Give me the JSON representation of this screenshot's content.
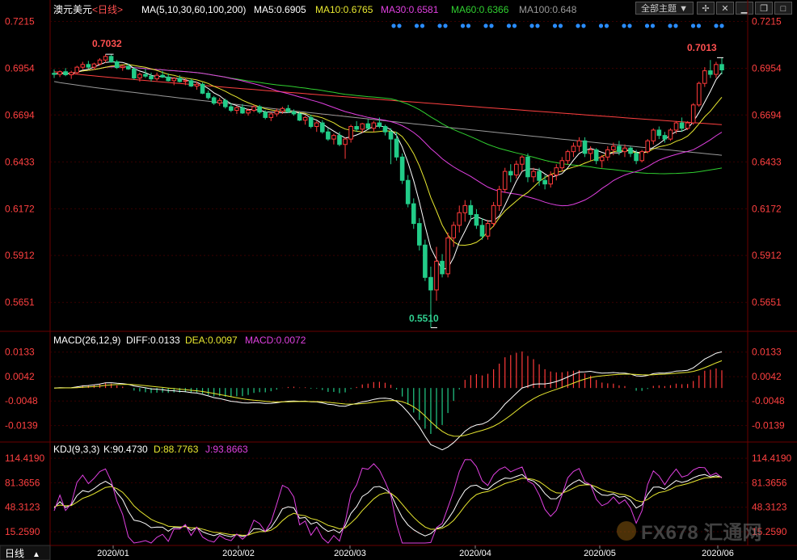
{
  "toolbar": {
    "theme_select": "全部主题",
    "icons": [
      "cross-icon",
      "close-icon",
      "minimize-icon",
      "restore-icon",
      "maximize-icon"
    ]
  },
  "price_panel": {
    "symbol": "澳元美元",
    "period_tag": "<日线>",
    "ma_header": "MA(5,10,30,60,100,200)",
    "ma_values": [
      {
        "label": "MA5:0.6905",
        "color": "#ffffff"
      },
      {
        "label": "MA10:0.6765",
        "color": "#e8e830"
      },
      {
        "label": "MA30:0.6581",
        "color": "#e040e0"
      },
      {
        "label": "MA60:0.6366",
        "color": "#30d030"
      },
      {
        "label": "MA100:0.648",
        "color": "#9a9a9a"
      }
    ],
    "annotations": {
      "high_left": "0.7032",
      "high_right": "0.7013",
      "low": "0.5510"
    }
  },
  "macd_panel": {
    "header": "MACD(26,12,9)",
    "diff": "DIFF:0.0133",
    "dea": "DEA:0.0097",
    "macd": "MACD:0.0072",
    "ticks": [
      "0.0133",
      "0.0042",
      "-0.0048",
      "-0.0139"
    ]
  },
  "kdj_panel": {
    "header": "KDJ(9,3,3)",
    "k": "K:90.4730",
    "d": "D:88.7763",
    "j": "J:93.8663",
    "ticks": [
      "114.4190",
      "81.3656",
      "48.3123",
      "15.2590"
    ]
  },
  "bottom_bar": {
    "period_label": "日线",
    "watermark": "FX678 汇通网"
  },
  "colors": {
    "up": "#ff3a3a",
    "down": "#22cc88",
    "axis_label": "#ff4040",
    "grid": "#3a0000",
    "ma5": "#ffffff",
    "ma10": "#e8e830",
    "ma30": "#e040e0",
    "ma60": "#30d030",
    "ma100": "#9a9a9a",
    "ma200": "#ff4040"
  },
  "chart_data": {
    "type": "candlestick",
    "x_axis_labels": [
      "2020/01",
      "2020/02",
      "2020/03",
      "2020/04",
      "2020/05",
      "2020/06"
    ],
    "price_axis_ticks": [
      0.7215,
      0.6954,
      0.6694,
      0.6433,
      0.6172,
      0.5912,
      0.5651
    ],
    "price_range": [
      0.549,
      0.7235
    ],
    "extremes": {
      "high": 0.7032,
      "recent_high": 0.7013,
      "low": 0.551
    },
    "ohlc": [
      [
        0.6926,
        0.6948,
        0.69,
        0.692
      ],
      [
        0.692,
        0.6942,
        0.6905,
        0.6935
      ],
      [
        0.6935,
        0.6955,
        0.691,
        0.6918
      ],
      [
        0.6918,
        0.694,
        0.6895,
        0.693
      ],
      [
        0.693,
        0.6968,
        0.692,
        0.696
      ],
      [
        0.696,
        0.699,
        0.6948,
        0.6975
      ],
      [
        0.6975,
        0.6995,
        0.695,
        0.696
      ],
      [
        0.696,
        0.6985,
        0.6945,
        0.6978
      ],
      [
        0.6978,
        0.701,
        0.697,
        0.7
      ],
      [
        0.7,
        0.7032,
        0.6985,
        0.702
      ],
      [
        0.702,
        0.703,
        0.6985,
        0.699
      ],
      [
        0.699,
        0.7,
        0.695,
        0.6958
      ],
      [
        0.6958,
        0.6975,
        0.694,
        0.6965
      ],
      [
        0.6965,
        0.698,
        0.6945,
        0.695
      ],
      [
        0.695,
        0.696,
        0.689,
        0.69
      ],
      [
        0.69,
        0.693,
        0.688,
        0.692
      ],
      [
        0.692,
        0.695,
        0.69,
        0.691
      ],
      [
        0.691,
        0.693,
        0.688,
        0.6895
      ],
      [
        0.6895,
        0.693,
        0.6885,
        0.6915
      ],
      [
        0.6915,
        0.694,
        0.69,
        0.6905
      ],
      [
        0.6905,
        0.6925,
        0.688,
        0.6885
      ],
      [
        0.6885,
        0.6905,
        0.686,
        0.6898
      ],
      [
        0.6898,
        0.6915,
        0.6875,
        0.688
      ],
      [
        0.688,
        0.69,
        0.686,
        0.6885
      ],
      [
        0.6885,
        0.6895,
        0.685,
        0.6855
      ],
      [
        0.6855,
        0.688,
        0.6835,
        0.6865
      ],
      [
        0.6865,
        0.6875,
        0.681,
        0.6815
      ],
      [
        0.6815,
        0.683,
        0.678,
        0.679
      ],
      [
        0.679,
        0.68,
        0.675,
        0.676
      ],
      [
        0.676,
        0.679,
        0.6745,
        0.6775
      ],
      [
        0.6775,
        0.6785,
        0.673,
        0.674
      ],
      [
        0.674,
        0.676,
        0.671,
        0.672
      ],
      [
        0.672,
        0.6745,
        0.67,
        0.6735
      ],
      [
        0.6735,
        0.6755,
        0.67,
        0.6705
      ],
      [
        0.6705,
        0.673,
        0.669,
        0.672
      ],
      [
        0.672,
        0.675,
        0.671,
        0.674
      ],
      [
        0.674,
        0.675,
        0.67,
        0.671
      ],
      [
        0.671,
        0.672,
        0.667,
        0.668
      ],
      [
        0.668,
        0.671,
        0.666,
        0.67
      ],
      [
        0.67,
        0.673,
        0.6685,
        0.6715
      ],
      [
        0.6715,
        0.674,
        0.67,
        0.673
      ],
      [
        0.673,
        0.675,
        0.6705,
        0.6712
      ],
      [
        0.6712,
        0.6725,
        0.669,
        0.67
      ],
      [
        0.67,
        0.671,
        0.666,
        0.6665
      ],
      [
        0.6665,
        0.669,
        0.664,
        0.668
      ],
      [
        0.668,
        0.6695,
        0.662,
        0.663
      ],
      [
        0.663,
        0.666,
        0.66,
        0.665
      ],
      [
        0.665,
        0.6665,
        0.659,
        0.66
      ],
      [
        0.66,
        0.662,
        0.655,
        0.656
      ],
      [
        0.656,
        0.659,
        0.653,
        0.658
      ],
      [
        0.658,
        0.66,
        0.652,
        0.653
      ],
      [
        0.653,
        0.657,
        0.645,
        0.656
      ],
      [
        0.656,
        0.664,
        0.654,
        0.663
      ],
      [
        0.663,
        0.666,
        0.66,
        0.6615
      ],
      [
        0.6615,
        0.665,
        0.6595,
        0.6645
      ],
      [
        0.6645,
        0.667,
        0.661,
        0.662
      ],
      [
        0.662,
        0.666,
        0.66,
        0.665
      ],
      [
        0.665,
        0.668,
        0.662,
        0.663
      ],
      [
        0.663,
        0.664,
        0.658,
        0.66
      ],
      [
        0.66,
        0.662,
        0.642,
        0.656
      ],
      [
        0.656,
        0.66,
        0.644,
        0.646
      ],
      [
        0.646,
        0.648,
        0.631,
        0.633
      ],
      [
        0.633,
        0.636,
        0.618,
        0.62
      ],
      [
        0.62,
        0.623,
        0.606,
        0.609
      ],
      [
        0.609,
        0.612,
        0.594,
        0.597
      ],
      [
        0.597,
        0.6,
        0.577,
        0.579
      ],
      [
        0.579,
        0.585,
        0.551,
        0.572
      ],
      [
        0.572,
        0.596,
        0.566,
        0.588
      ],
      [
        0.588,
        0.592,
        0.579,
        0.581
      ],
      [
        0.581,
        0.604,
        0.579,
        0.601
      ],
      [
        0.601,
        0.61,
        0.596,
        0.608
      ],
      [
        0.608,
        0.619,
        0.604,
        0.615
      ],
      [
        0.615,
        0.622,
        0.61,
        0.619
      ],
      [
        0.619,
        0.622,
        0.611,
        0.614
      ],
      [
        0.614,
        0.617,
        0.606,
        0.608
      ],
      [
        0.608,
        0.612,
        0.6,
        0.602
      ],
      [
        0.602,
        0.611,
        0.6,
        0.609
      ],
      [
        0.609,
        0.621,
        0.607,
        0.619
      ],
      [
        0.619,
        0.63,
        0.616,
        0.628
      ],
      [
        0.628,
        0.64,
        0.626,
        0.638
      ],
      [
        0.638,
        0.642,
        0.632,
        0.636
      ],
      [
        0.636,
        0.644,
        0.634,
        0.642
      ],
      [
        0.642,
        0.647,
        0.638,
        0.646
      ],
      [
        0.646,
        0.648,
        0.632,
        0.635
      ],
      [
        0.635,
        0.64,
        0.632,
        0.638
      ],
      [
        0.638,
        0.64,
        0.63,
        0.633
      ],
      [
        0.633,
        0.636,
        0.628,
        0.631
      ],
      [
        0.631,
        0.638,
        0.629,
        0.636
      ],
      [
        0.636,
        0.642,
        0.633,
        0.64
      ],
      [
        0.64,
        0.646,
        0.638,
        0.644
      ],
      [
        0.644,
        0.65,
        0.642,
        0.649
      ],
      [
        0.649,
        0.654,
        0.646,
        0.652
      ],
      [
        0.652,
        0.657,
        0.649,
        0.655
      ],
      [
        0.655,
        0.657,
        0.646,
        0.648
      ],
      [
        0.648,
        0.652,
        0.644,
        0.65
      ],
      [
        0.65,
        0.651,
        0.642,
        0.644
      ],
      [
        0.644,
        0.647,
        0.64,
        0.646
      ],
      [
        0.646,
        0.652,
        0.644,
        0.65
      ],
      [
        0.65,
        0.654,
        0.647,
        0.652
      ],
      [
        0.652,
        0.655,
        0.647,
        0.649
      ],
      [
        0.649,
        0.653,
        0.646,
        0.651
      ],
      [
        0.651,
        0.652,
        0.646,
        0.648
      ],
      [
        0.648,
        0.65,
        0.642,
        0.644
      ],
      [
        0.644,
        0.65,
        0.643,
        0.649
      ],
      [
        0.649,
        0.656,
        0.648,
        0.655
      ],
      [
        0.655,
        0.662,
        0.653,
        0.661
      ],
      [
        0.661,
        0.663,
        0.656,
        0.658
      ],
      [
        0.658,
        0.66,
        0.654,
        0.656
      ],
      [
        0.656,
        0.662,
        0.655,
        0.661
      ],
      [
        0.661,
        0.666,
        0.659,
        0.665
      ],
      [
        0.665,
        0.668,
        0.66,
        0.662
      ],
      [
        0.662,
        0.666,
        0.661,
        0.665
      ],
      [
        0.665,
        0.676,
        0.664,
        0.675
      ],
      [
        0.675,
        0.688,
        0.674,
        0.687
      ],
      [
        0.687,
        0.696,
        0.685,
        0.694
      ],
      [
        0.694,
        0.7,
        0.69,
        0.692
      ],
      [
        0.692,
        0.699,
        0.69,
        0.6975
      ],
      [
        0.6975,
        0.7013,
        0.692,
        0.6945
      ]
    ]
  }
}
